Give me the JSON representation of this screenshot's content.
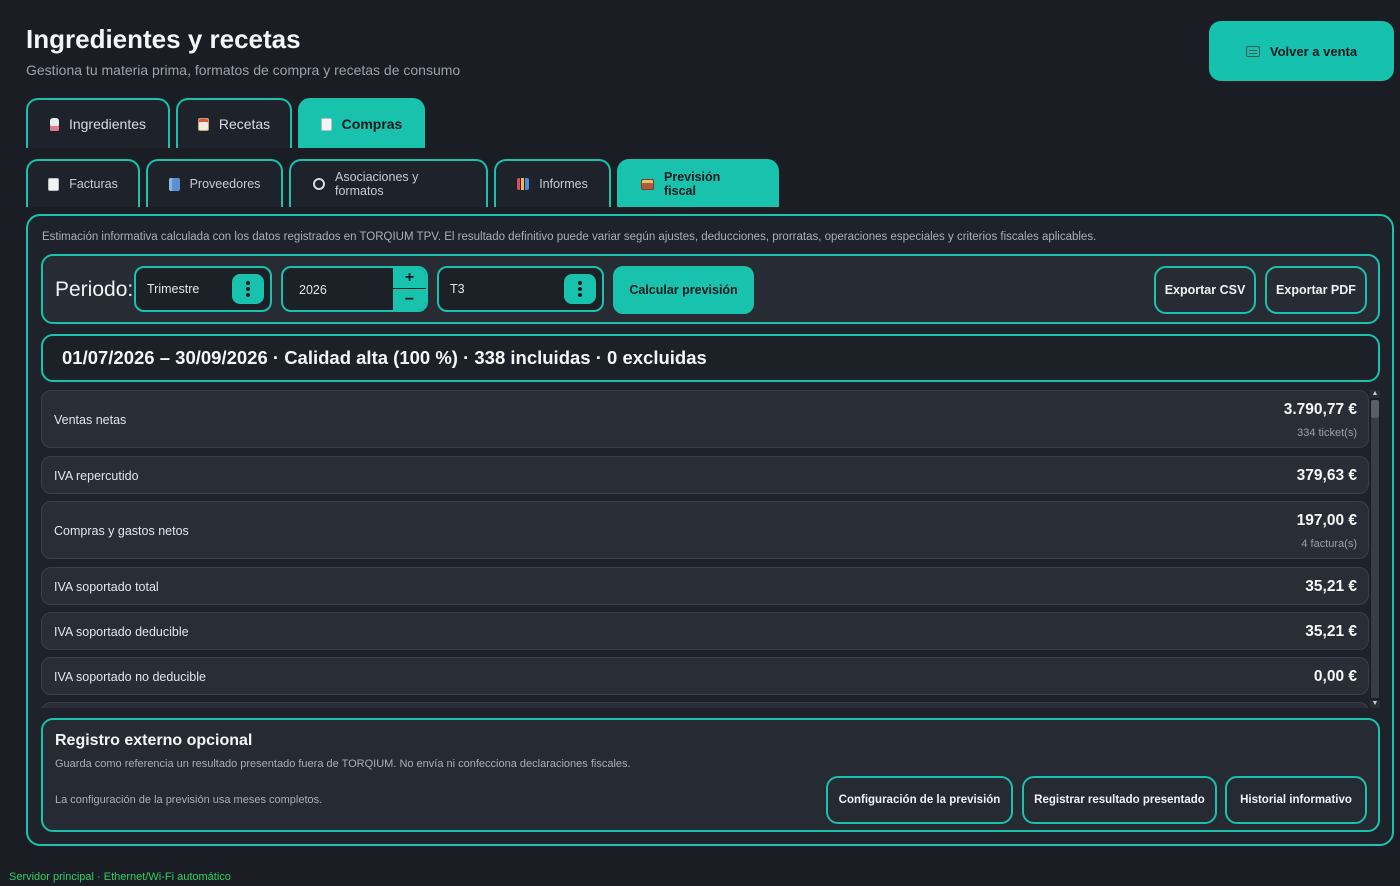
{
  "header": {
    "title": "Ingredientes y recetas",
    "subtitle": "Gestiona tu materia prima, formatos de compra y recetas de consumo",
    "back_button": {
      "label": "Volver a venta",
      "icon": "cash-register-icon"
    }
  },
  "main_tabs": [
    {
      "label": "Ingredientes",
      "icon": "bottle-icon",
      "active": false
    },
    {
      "label": "Recetas",
      "icon": "clipboard-icon",
      "active": false
    },
    {
      "label": "Compras",
      "icon": "receipt-icon",
      "active": true
    }
  ],
  "sub_tabs": [
    {
      "label": "Facturas",
      "icon": "receipt-icon",
      "active": false
    },
    {
      "label": "Proveedores",
      "icon": "building-icon",
      "active": false
    },
    {
      "label": "Asociaciones y formatos",
      "icon": "link-icon",
      "active": false
    },
    {
      "label": "Informes",
      "icon": "bar-chart-icon",
      "active": false
    },
    {
      "label": "Previsión fiscal",
      "icon": "abacus-icon",
      "active": true
    }
  ],
  "panel": {
    "disclaimer": "Estimación informativa calculada con los datos registrados en TORQIUM TPV. El resultado definitivo puede variar según ajustes, deducciones, prorratas, operaciones especiales y criterios fiscales aplicables.",
    "toolbar": {
      "period_label": "Periodo:",
      "period_type": "Trimestre",
      "year": "2026",
      "step_up": "+",
      "step_down": "−",
      "quarter": "T3",
      "calculate_label": "Calcular previsión",
      "export_csv_label": "Exportar CSV",
      "export_pdf_label": "Exportar PDF"
    },
    "summary": "01/07/2026 – 30/09/2026 · Calidad alta (100 %) · 338 incluidas · 0 excluidas",
    "rows": [
      {
        "label": "Ventas netas",
        "amount": "3.790,77 €",
        "detail": "334 ticket(s)"
      },
      {
        "label": "IVA repercutido",
        "amount": "379,63 €",
        "detail": ""
      },
      {
        "label": "Compras y gastos netos",
        "amount": "197,00 €",
        "detail": "4 factura(s)"
      },
      {
        "label": "IVA soportado total",
        "amount": "35,21 €",
        "detail": ""
      },
      {
        "label": "IVA soportado deducible",
        "amount": "35,21 €",
        "detail": ""
      },
      {
        "label": "IVA soportado no deducible",
        "amount": "0,00 €",
        "detail": ""
      }
    ],
    "external": {
      "title": "Registro externo opcional",
      "description": "Guarda como referencia un resultado presentado fuera de TORQIUM. No envía ni confecciona declaraciones fiscales.",
      "note": "La configuración de la previsión usa meses completos.",
      "config_label": "Configuración de la previsión",
      "register_label": "Registrar resultado presentado",
      "history_label": "Historial informativo"
    }
  },
  "footer": {
    "status": "Servidor principal · Ethernet/Wi-Fi automático"
  },
  "colors": {
    "accent": "#19c2ad",
    "background": "#1a1d24",
    "status_ok": "#2ecf63"
  }
}
